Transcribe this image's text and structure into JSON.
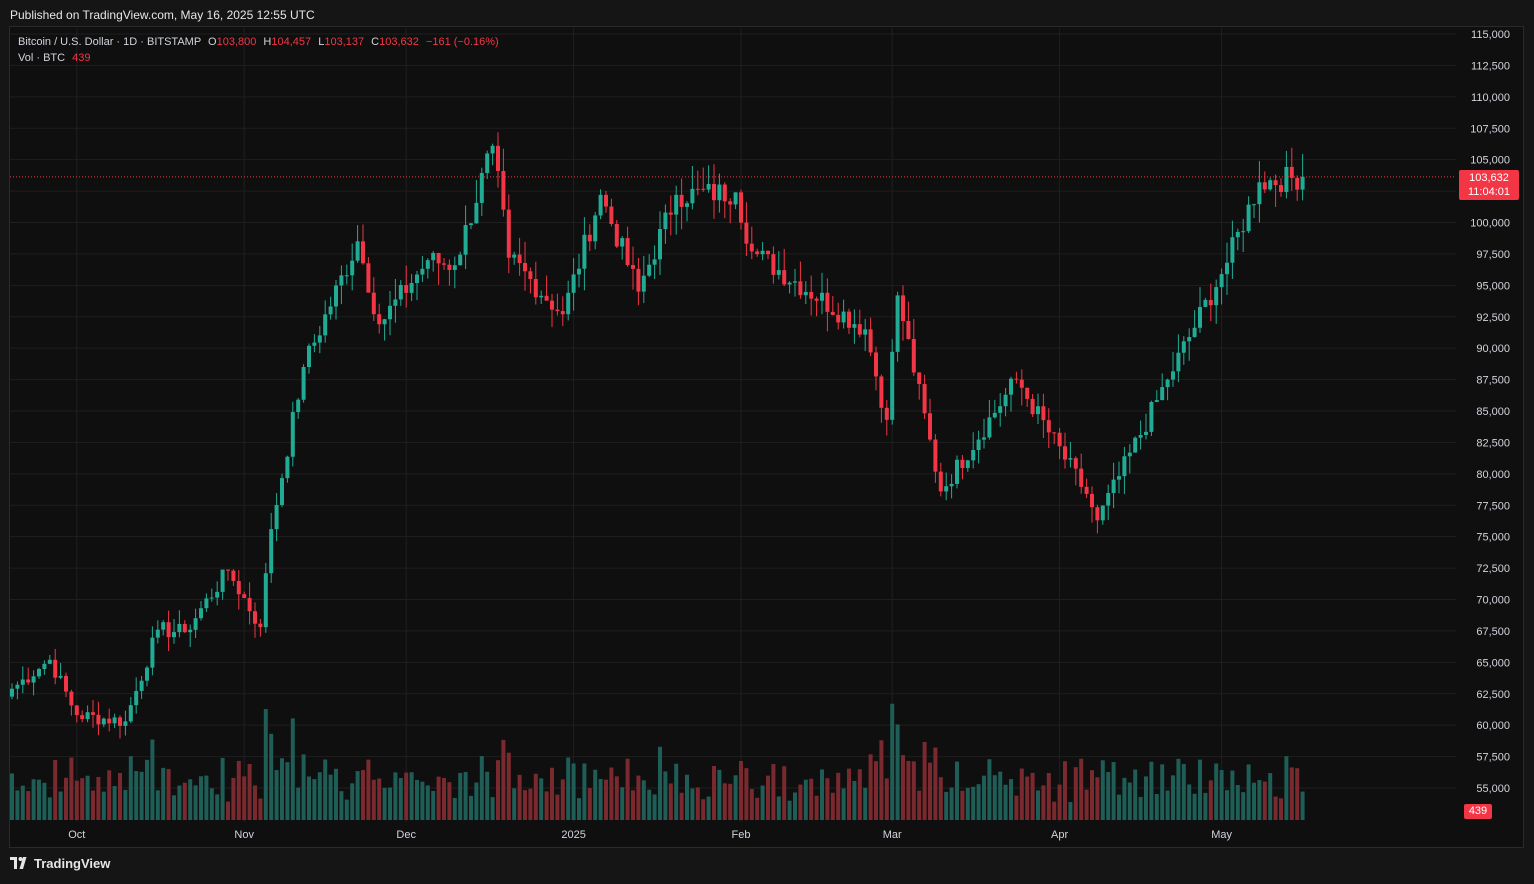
{
  "header": {
    "published": "Published on TradingView.com, May 16, 2025 12:55 UTC"
  },
  "legend": {
    "symbol": "Bitcoin / U.S. Dollar · 1D · BITSTAMP",
    "o_label": "O",
    "o_value": "103,800",
    "h_label": "H",
    "h_value": "104,457",
    "l_label": "L",
    "l_value": "103,137",
    "c_label": "C",
    "c_value": "103,632",
    "change": "−161 (−0.16%)",
    "vol_label": "Vol · BTC",
    "vol_value": "439"
  },
  "price_badge": {
    "price": "103,632",
    "countdown": "11:04:01"
  },
  "volume_badge": "439",
  "footer": {
    "brand": "TradingView"
  },
  "colors": {
    "up": "#22ab94",
    "down": "#f23645",
    "background": "#0f0f0f",
    "grid": "#1f1f1f"
  },
  "chart_data": {
    "type": "candlestick",
    "title": "Bitcoin / U.S. Dollar · 1D · BITSTAMP",
    "xlabel": "",
    "ylabel": "",
    "ylim": [
      53000,
      116000
    ],
    "y_ticks": [
      "115,000",
      "112,500",
      "110,000",
      "107,500",
      "105,000",
      "102,500",
      "100,000",
      "97,500",
      "95,000",
      "92,500",
      "90,000",
      "87,500",
      "85,000",
      "82,500",
      "80,000",
      "77,500",
      "75,000",
      "72,500",
      "70,000",
      "67,500",
      "65,000",
      "62,500",
      "60,000",
      "57,500",
      "55,000"
    ],
    "x_ticks": [
      "Oct",
      "Nov",
      "Dec",
      "2025",
      "Feb",
      "Mar",
      "Apr",
      "May"
    ],
    "last_price": 103632,
    "series_close_approx": [
      {
        "date": "2024-09-19",
        "close": 62900
      },
      {
        "date": "2024-09-26",
        "close": 65200
      },
      {
        "date": "2024-10-01",
        "close": 60800
      },
      {
        "date": "2024-10-10",
        "close": 60300
      },
      {
        "date": "2024-10-16",
        "close": 67600
      },
      {
        "date": "2024-10-21",
        "close": 67400
      },
      {
        "date": "2024-10-29",
        "close": 72300
      },
      {
        "date": "2024-11-04",
        "close": 67800
      },
      {
        "date": "2024-11-06",
        "close": 75600
      },
      {
        "date": "2024-11-12",
        "close": 88500
      },
      {
        "date": "2024-11-22",
        "close": 98500
      },
      {
        "date": "2024-11-26",
        "close": 91900
      },
      {
        "date": "2024-12-05",
        "close": 97000
      },
      {
        "date": "2024-12-10",
        "close": 96600
      },
      {
        "date": "2024-12-17",
        "close": 106100
      },
      {
        "date": "2024-12-20",
        "close": 97200
      },
      {
        "date": "2024-12-30",
        "close": 92700
      },
      {
        "date": "2025-01-06",
        "close": 102200
      },
      {
        "date": "2025-01-13",
        "close": 94500
      },
      {
        "date": "2025-01-20",
        "close": 102200
      },
      {
        "date": "2025-01-31",
        "close": 102400
      },
      {
        "date": "2025-02-03",
        "close": 97700
      },
      {
        "date": "2025-02-24",
        "close": 91500
      },
      {
        "date": "2025-02-28",
        "close": 84300
      },
      {
        "date": "2025-03-02",
        "close": 94200
      },
      {
        "date": "2025-03-10",
        "close": 78600
      },
      {
        "date": "2025-03-24",
        "close": 87500
      },
      {
        "date": "2025-04-06",
        "close": 78400
      },
      {
        "date": "2025-04-08",
        "close": 76300
      },
      {
        "date": "2025-04-21",
        "close": 87500
      },
      {
        "date": "2025-05-02",
        "close": 96800
      },
      {
        "date": "2025-05-08",
        "close": 103200
      },
      {
        "date": "2025-05-16",
        "close": 103632
      }
    ],
    "volume": {
      "unit": "BTC",
      "last": 439
    }
  }
}
